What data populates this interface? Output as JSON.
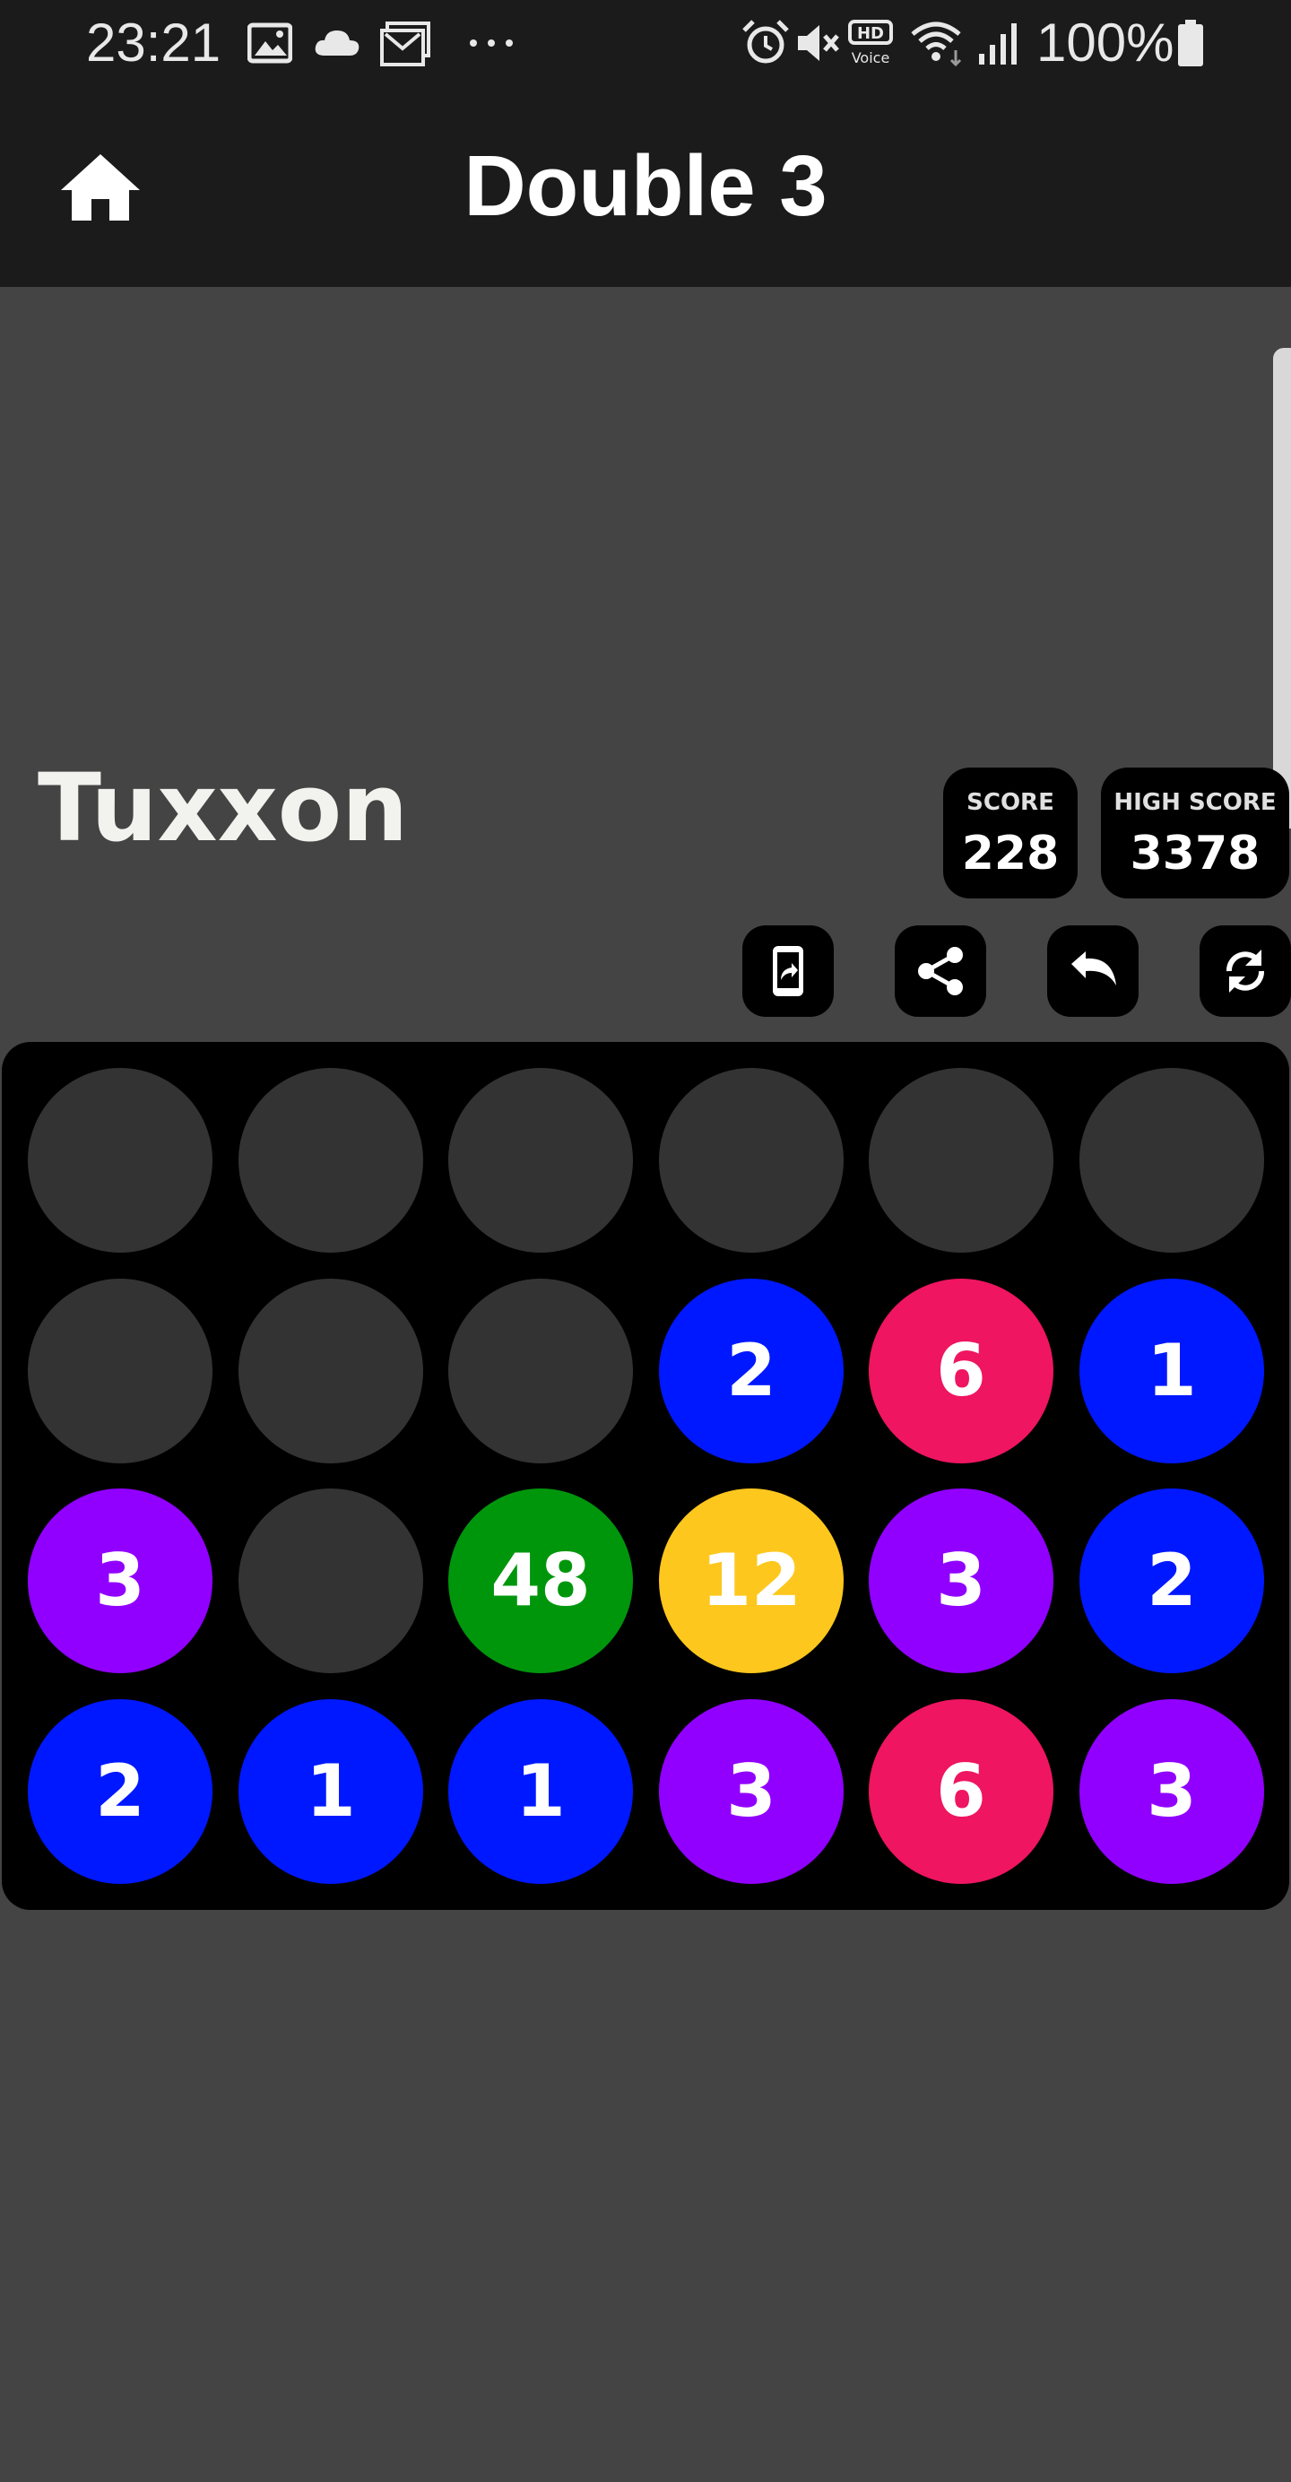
{
  "status_bar": {
    "time": "23:21",
    "battery": "100%",
    "icons": [
      "image-icon",
      "cloud-icon",
      "mail-icon",
      "more-icon",
      "alarm-icon",
      "mute-icon",
      "hd-voice-icon",
      "wifi-icon",
      "signal-icon",
      "battery-icon"
    ]
  },
  "app_bar": {
    "title": "Double 3",
    "home_icon": "home-icon"
  },
  "player": {
    "name": "Tuxxon"
  },
  "scores": {
    "score_label": "SCORE",
    "score_value": "228",
    "high_label": "HIGH SCORE",
    "high_value": "3378"
  },
  "actions": [
    "phone-share-icon",
    "share-icon",
    "undo-icon",
    "restart-icon"
  ],
  "colors": {
    "background": "#444444",
    "bar": "#1b1b1b",
    "empty": "#333333",
    "1": "#0018ff",
    "2": "#0018ff",
    "3": "#9100ff",
    "6": "#ef1560",
    "12": "#fdc71d",
    "48": "#00960c"
  },
  "board": {
    "rows": 4,
    "cols": 6,
    "cells": [
      [
        "",
        "",
        "",
        "",
        "",
        ""
      ],
      [
        "",
        "",
        "",
        "2",
        "6",
        "1"
      ],
      [
        "3",
        "",
        "48",
        "12",
        "3",
        "2"
      ],
      [
        "2",
        "1",
        "1",
        "3",
        "6",
        "3"
      ]
    ]
  }
}
